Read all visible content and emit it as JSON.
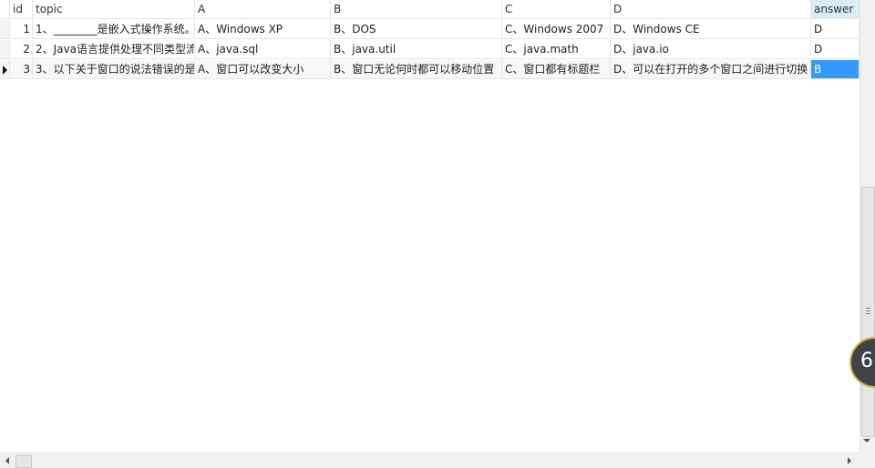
{
  "columns": {
    "id": "id",
    "topic": "topic",
    "a": "A",
    "b": "B",
    "c": "C",
    "d": "D",
    "answer": "answer"
  },
  "rows": [
    {
      "id": "1",
      "topic": "1、________是嵌入式操作系统。",
      "a": "A、Windows XP",
      "b": "B、DOS",
      "c": "C、Windows 2007",
      "d": "D、Windows CE",
      "answer": "D"
    },
    {
      "id": "2",
      "topic": "2、Java语言提供处理不同类型流",
      "a": "A、java.sql",
      "b": "B、java.util",
      "c": "C、java.math",
      "d": "D、java.io",
      "answer": "D"
    },
    {
      "id": "3",
      "topic": "3、以下关于窗口的说法错误的是",
      "a": "A、窗口可以改变大小",
      "b": "B、窗口无论何时都可以移动位置",
      "c": "C、窗口都有标题栏",
      "d": "D、可以在打开的多个窗口之间进行切换",
      "answer": "B"
    }
  ],
  "selected_row": 3,
  "bubble": {
    "text": "6"
  },
  "colors": {
    "selection": "#3399ff",
    "header_highlight": "#d8ecf8"
  }
}
